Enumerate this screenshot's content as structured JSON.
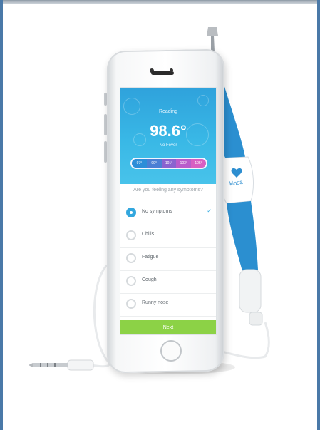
{
  "screen": {
    "header_title": "Reading",
    "temperature": "98.6°",
    "status": "No Fever",
    "scale": [
      {
        "label": "97°",
        "color": "#2d8ed8"
      },
      {
        "label": "99°",
        "color": "#4b7fd4"
      },
      {
        "label": "101°",
        "color": "#8a63cf"
      },
      {
        "label": "103°",
        "color": "#b95ccb"
      },
      {
        "label": "105°",
        "color": "#d85fc2"
      }
    ],
    "question": "Are you feeling any symptoms?",
    "symptoms": [
      {
        "label": "No symptoms",
        "selected": true
      },
      {
        "label": "Chills",
        "selected": false
      },
      {
        "label": "Fatigue",
        "selected": false
      },
      {
        "label": "Cough",
        "selected": false
      },
      {
        "label": "Runny nose",
        "selected": false
      }
    ],
    "next_button": "Next"
  },
  "device": {
    "brand": "kinsa",
    "brand_color": "#2d8ed0",
    "probe_color": "#2b8fd0"
  }
}
